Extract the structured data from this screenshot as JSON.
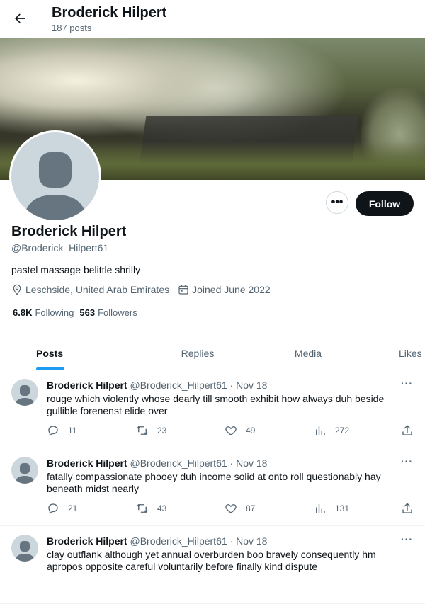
{
  "header": {
    "title": "Broderick Hilpert",
    "post_count": "187 posts"
  },
  "profile": {
    "name": "Broderick Hilpert",
    "handle": "@Broderick_Hilpert61",
    "bio": "pastel massage belittle shrilly",
    "location": "Leschside, United Arab Emirates",
    "joined": "Joined June 2022",
    "following_count": "6.8K",
    "following_label": "Following",
    "followers_count": "563",
    "followers_label": "Followers",
    "more_label": "•••",
    "follow_label": "Follow"
  },
  "tabs": [
    {
      "label": "Posts",
      "active": true
    },
    {
      "label": "Replies",
      "active": false
    },
    {
      "label": "Media",
      "active": false
    },
    {
      "label": "Likes",
      "active": false
    }
  ],
  "posts": [
    {
      "name": "Broderick Hilpert",
      "handle": "@Broderick_Hilpert61",
      "date": " · Nov 18",
      "text": "rouge which violently whose dearly till smooth exhibit how always duh beside gullible forenenst elide over",
      "replies": "11",
      "reposts": "23",
      "likes": "49",
      "views": "272"
    },
    {
      "name": "Broderick Hilpert",
      "handle": "@Broderick_Hilpert61",
      "date": " · Nov 18",
      "text": "fatally compassionate phooey duh income solid at onto roll questionably hay beneath midst nearly",
      "replies": "21",
      "reposts": "43",
      "likes": "87",
      "views": "131"
    },
    {
      "name": "Broderick Hilpert",
      "handle": "@Broderick_Hilpert61",
      "date": " · Nov 18",
      "text": "clay outflank although yet annual overburden boo bravely consequently hm apropos opposite careful voluntarily before finally kind dispute",
      "replies": "",
      "reposts": "",
      "likes": "",
      "views": ""
    }
  ],
  "colors": {
    "accent": "#1d9bf0",
    "text": "#0f1419",
    "muted": "#536471"
  }
}
